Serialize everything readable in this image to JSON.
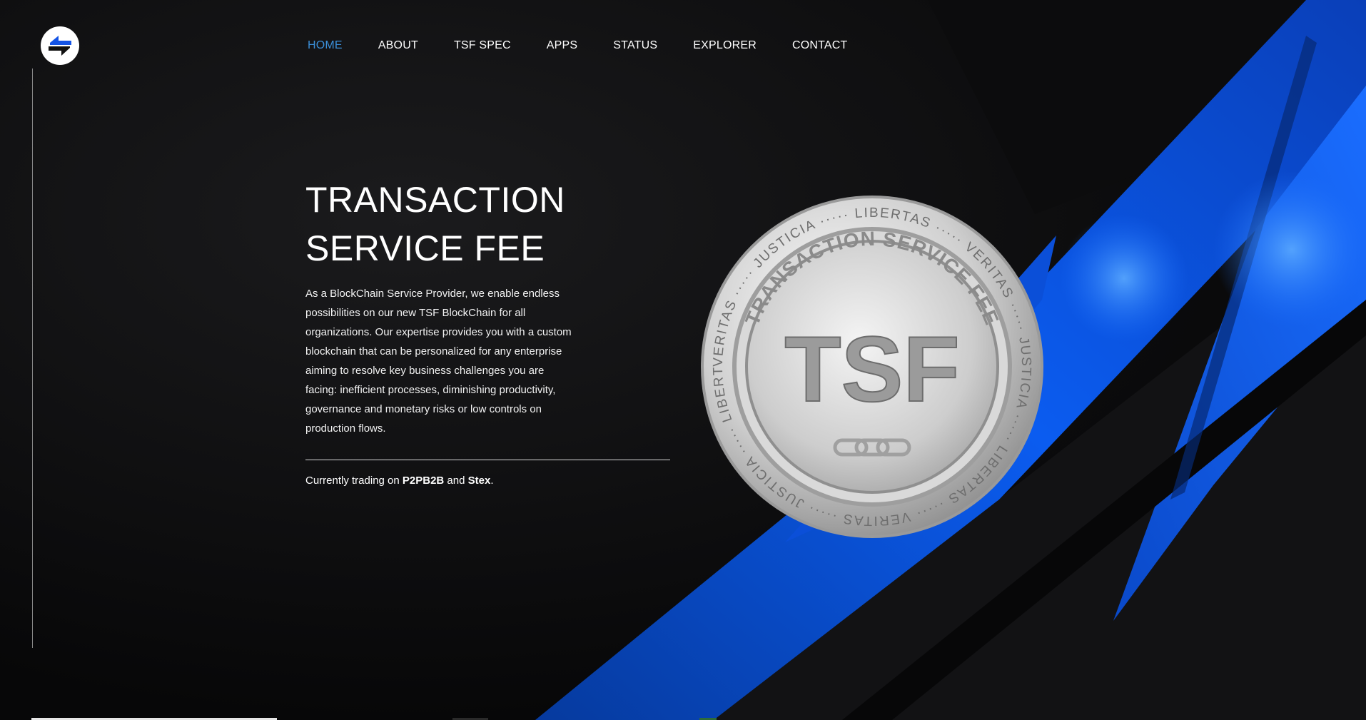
{
  "nav": {
    "items": [
      {
        "label": "HOME",
        "active": true
      },
      {
        "label": "ABOUT",
        "active": false
      },
      {
        "label": "TSF SPEC",
        "active": false
      },
      {
        "label": "APPS",
        "active": false
      },
      {
        "label": "STATUS",
        "active": false
      },
      {
        "label": "EXPLORER",
        "active": false
      },
      {
        "label": "CONTACT",
        "active": false
      }
    ]
  },
  "logo": {
    "icon": "swap-arrows-icon"
  },
  "hero": {
    "title_line1": "TRANSACTION",
    "title_line2": "SERVICE FEE",
    "description": "As a BlockChain Service Provider, we enable endless possibilities on our new TSF BlockChain for all organizations. Our expertise provides you with a custom blockchain that can be personalized for any enterprise aiming to resolve key business challenges you are facing: inefficient processes, diminishing productivity, governance and monetary risks or low controls on production flows.",
    "trading_prefix": "Currently trading on ",
    "exchange1": "P2PB2B",
    "trading_and": " and ",
    "exchange2": "Stex",
    "trading_suffix": "."
  },
  "coin": {
    "center_text": "TSF",
    "inner_ring_text": "TRANSACTION SERVICE FEE",
    "ring_words": [
      "VERITAS",
      "JUSTICIA",
      "LIBERTAS",
      "VERITAS",
      "JUSTICIA",
      "LIBERTAS",
      "VERITAS",
      "JUSTICIA",
      "LIBERTAS"
    ]
  },
  "colors": {
    "accent": "#3b8fd8",
    "background": "#0b0b0c",
    "brand_blue": "#0a4fd6"
  }
}
